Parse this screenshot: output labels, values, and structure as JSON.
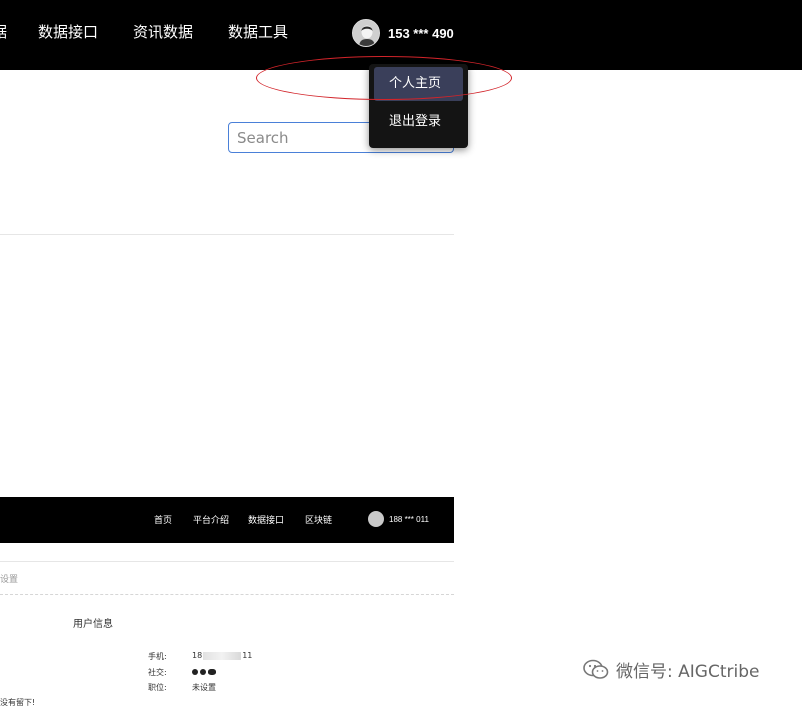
{
  "nav": {
    "items": [
      {
        "label": "据"
      },
      {
        "label": "数据接口"
      },
      {
        "label": "资讯数据"
      },
      {
        "label": "数据工具"
      }
    ],
    "user": {
      "phone": "153 *** 490",
      "avatar_icon": "user-avatar-icon"
    }
  },
  "dropdown": {
    "items": [
      {
        "label": "个人主页",
        "active": true
      },
      {
        "label": "退出登录",
        "active": false
      }
    ]
  },
  "highlight": {
    "color": "#d2242a"
  },
  "search": {
    "placeholder": "Search",
    "value": ""
  },
  "embedded": {
    "nav": [
      {
        "label": "首页"
      },
      {
        "label": "平台介绍"
      },
      {
        "label": "数据接口"
      },
      {
        "label": "区块链"
      }
    ],
    "user_phone": "188 *** 011",
    "settings_label": "设置",
    "section_title": "用户信息",
    "fields": [
      {
        "label": "手机:",
        "value_prefix": "18",
        "value_suffix": "11"
      },
      {
        "label": "社交:",
        "value": ""
      },
      {
        "label": "职位:",
        "value": "未设置"
      }
    ],
    "bottom_text": "没有留下!"
  },
  "watermark": {
    "text": "微信号: AIGCtribe"
  },
  "colors": {
    "topbar": "#000000",
    "dropdown_bg": "#141414",
    "dropdown_active": "#3a3f5a",
    "search_border": "#4a80d8"
  }
}
